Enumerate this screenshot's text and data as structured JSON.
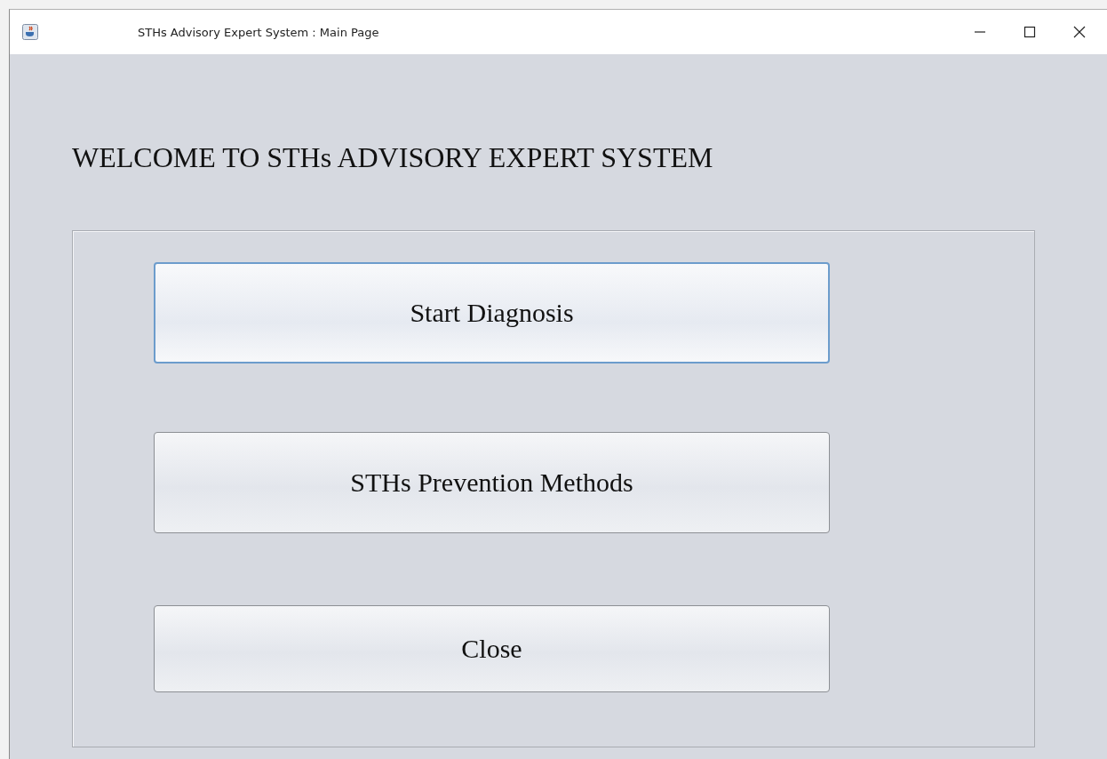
{
  "window": {
    "title": "STHs Advisory Expert System : Main Page"
  },
  "heading": "WELCOME TO STHs ADVISORY EXPERT SYSTEM",
  "buttons": [
    {
      "label": "Start Diagnosis",
      "focused": true
    },
    {
      "label": "STHs Prevention Methods",
      "focused": false
    },
    {
      "label": "Close",
      "focused": false
    }
  ]
}
